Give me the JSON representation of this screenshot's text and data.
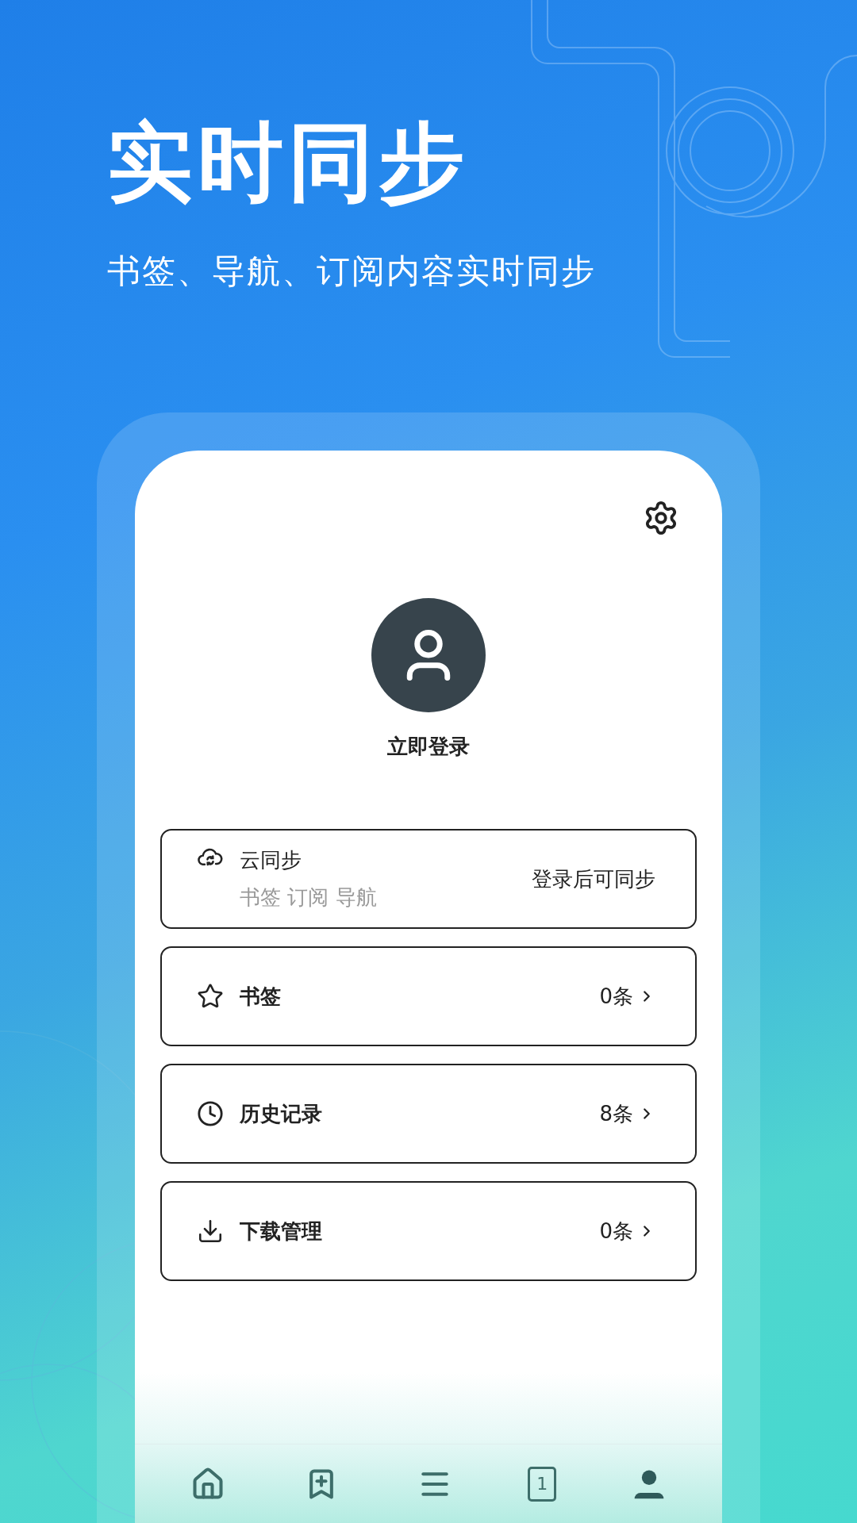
{
  "headline": "实时同步",
  "subtitle": "书签、导航、订阅内容实时同步",
  "profile": {
    "login": "立即登录"
  },
  "items": [
    {
      "kind": "sync",
      "title": "云同步",
      "detail": "书签 订阅 导航",
      "status": "登录后可同步"
    },
    {
      "kind": "bookmarks",
      "title": "书签",
      "count": "0条"
    },
    {
      "kind": "history",
      "title": "历史记录",
      "count": "8条"
    },
    {
      "kind": "downloads",
      "title": "下载管理",
      "count": "0条"
    }
  ],
  "nav": [
    {
      "kind": "home",
      "selected": false
    },
    {
      "kind": "add-bookmark",
      "selected": false
    },
    {
      "kind": "menu",
      "selected": false
    },
    {
      "kind": "tabs",
      "label": "1",
      "selected": false
    },
    {
      "kind": "profile",
      "selected": true
    }
  ]
}
